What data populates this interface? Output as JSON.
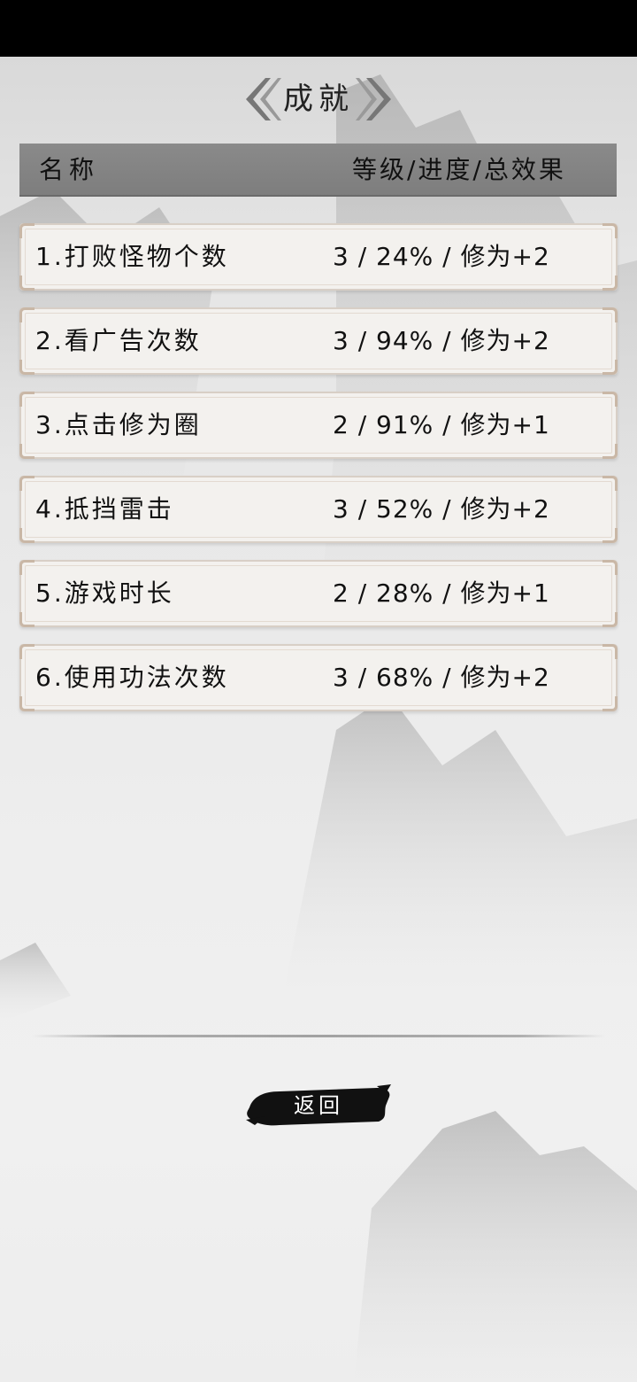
{
  "page": {
    "title": "成就"
  },
  "table": {
    "header": {
      "name": "名称",
      "stats": "等级/进度/总效果"
    },
    "rows": [
      {
        "name": "1.打败怪物个数",
        "stats": "3 / 24% / 修为+2"
      },
      {
        "name": "2.看广告次数",
        "stats": "3 / 94% / 修为+2"
      },
      {
        "name": "3.点击修为圈",
        "stats": "2 / 91% / 修为+1"
      },
      {
        "name": "4.抵挡雷击",
        "stats": "3 / 52% / 修为+2"
      },
      {
        "name": "5.游戏时长",
        "stats": "2 / 28% / 修为+1"
      },
      {
        "name": "6.使用功法次数",
        "stats": "3 / 68% / 修为+2"
      }
    ]
  },
  "footer": {
    "back_label": "返回"
  },
  "colors": {
    "header_bg": "#808080",
    "row_bg": "#f3f1ee",
    "row_border": "#d8cfc6",
    "button_bg": "#111111",
    "text": "#111111"
  },
  "icons": {
    "title_left": "double-chevron-left-icon",
    "title_right": "double-chevron-right-icon"
  }
}
